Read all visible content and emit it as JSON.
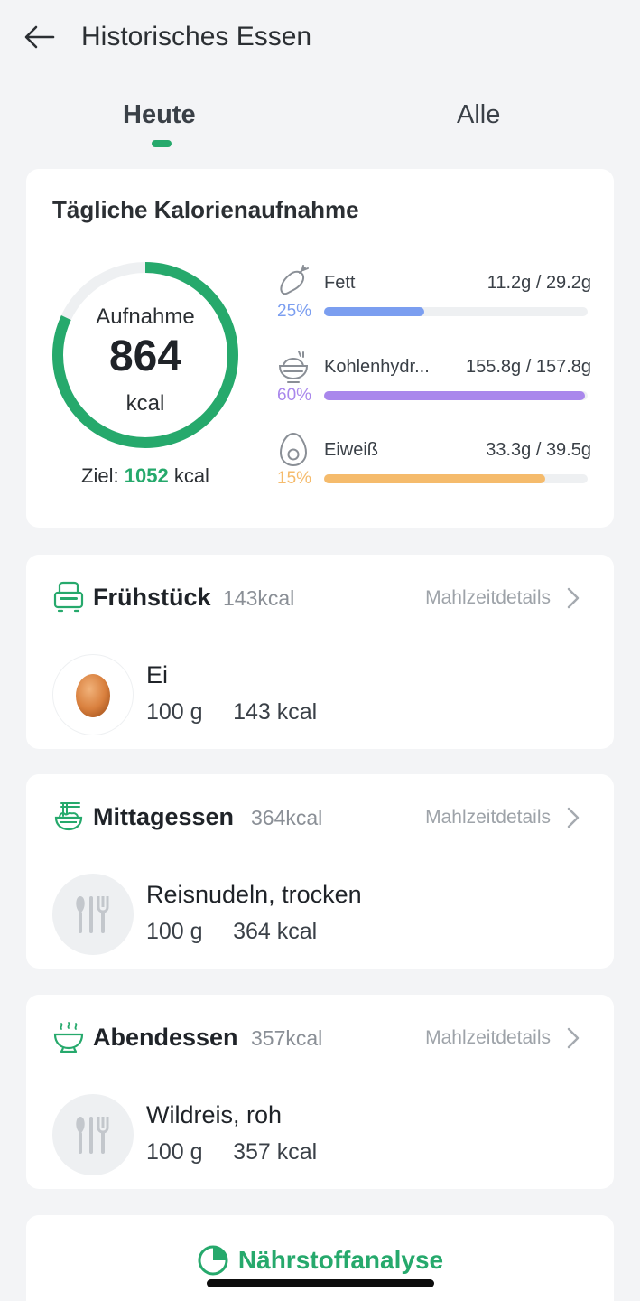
{
  "header": {
    "title": "Historisches Essen",
    "back_icon": "arrow-left-icon"
  },
  "tabs": [
    {
      "label": "Heute",
      "active": true
    },
    {
      "label": "Alle",
      "active": false
    }
  ],
  "intake": {
    "title": "Tägliche Kalorienaufnahme",
    "ring_label": "Aufnahme",
    "value": "864",
    "unit": "kcal",
    "progress_fraction": 0.82,
    "goal_prefix": "Ziel:",
    "goal_value": "1052",
    "goal_unit": "kcal",
    "accent_color": "#26a96c",
    "macros": [
      {
        "name": "Fett",
        "icon": "drumstick-icon",
        "percent": "25%",
        "amount": "11.2g / 29.2g",
        "fill_fraction": 0.38,
        "color": "#7b9ef0"
      },
      {
        "name": "Kohlenhydr...",
        "icon": "rice-bowl-icon",
        "percent": "60%",
        "amount": "155.8g / 157.8g",
        "fill_fraction": 0.99,
        "color": "#a987ec"
      },
      {
        "name": "Eiweiß",
        "icon": "egg-icon",
        "percent": "15%",
        "amount": "33.3g / 39.5g",
        "fill_fraction": 0.84,
        "color": "#f5bb6c"
      }
    ]
  },
  "meals": [
    {
      "name": "Frühstück",
      "kcal": "143kcal",
      "details_label": "Mahlzeitdetails",
      "icon": "toaster-icon",
      "food": {
        "name": "Ei",
        "amount": "100 g",
        "kcal": "143 kcal",
        "image": "egg-image"
      }
    },
    {
      "name": "Mittagessen",
      "kcal": "364kcal",
      "details_label": "Mahlzeitdetails",
      "icon": "noodles-icon",
      "food": {
        "name": "Reisnudeln, trocken",
        "amount": "100 g",
        "kcal": "364 kcal",
        "image": "cutlery-icon"
      }
    },
    {
      "name": "Abendessen",
      "kcal": "357kcal",
      "details_label": "Mahlzeitdetails",
      "icon": "soup-bowl-icon",
      "food": {
        "name": "Wildreis, roh",
        "amount": "100 g",
        "kcal": "357 kcal",
        "image": "cutlery-icon"
      }
    }
  ],
  "analysis": {
    "label": "Nährstoffanalyse",
    "icon": "pie-chart-icon"
  }
}
